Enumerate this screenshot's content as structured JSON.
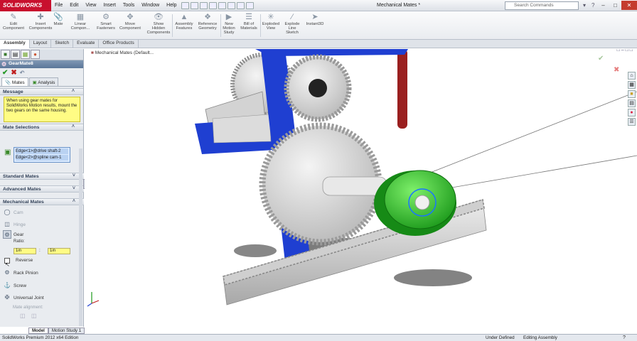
{
  "app": {
    "logo_text": "SOLIDWORKS",
    "document_title": "Mechanical Mates *"
  },
  "menu": [
    "File",
    "Edit",
    "View",
    "Insert",
    "Tools",
    "Window",
    "Help"
  ],
  "search": {
    "placeholder": "Search Commands"
  },
  "command_buttons": [
    {
      "label": "Edit\nComponent",
      "icon": "edit-icon"
    },
    {
      "label": "Insert\nComponents",
      "icon": "insert-icon"
    },
    {
      "label": "Mate",
      "icon": "mate-icon"
    },
    {
      "label": "Linear\nCompon...",
      "icon": "linear-icon"
    },
    {
      "label": "Smart\nFasteners",
      "icon": "fastener-icon"
    },
    {
      "label": "Move\nComponent",
      "icon": "move-icon"
    },
    {
      "label": "Show\nHidden\nComponents",
      "icon": "show-icon"
    },
    {
      "label": "Assembly\nFeatures",
      "icon": "features-icon"
    },
    {
      "label": "Reference\nGeometry",
      "icon": "geometry-icon"
    },
    {
      "label": "New\nMotion\nStudy",
      "icon": "motion-icon"
    },
    {
      "label": "Bill of\nMaterials",
      "icon": "bom-icon"
    },
    {
      "label": "Exploded\nView",
      "icon": "explode-icon"
    },
    {
      "label": "Explode\nLine\nSketch",
      "icon": "line-icon"
    },
    {
      "label": "Instant3D",
      "icon": "instant3d-icon"
    }
  ],
  "tabs": [
    "Assembly",
    "Layout",
    "Sketch",
    "Evaluate",
    "Office Products"
  ],
  "panel": {
    "title": "GearMate8",
    "mates_tab": "Mates",
    "analysis_tab": "Analysis",
    "message_header": "Message",
    "message_text": "When using gear mates for SolidWorks Motion results, mount the two gears on the same housing.",
    "selections_header": "Mate Selections",
    "selections": [
      "Edge<1>@drive shaft-2",
      "Edge<2>@spline cam-1"
    ],
    "standard_header": "Standard Mates",
    "advanced_header": "Advanced Mates",
    "mechanical_header": "Mechanical Mates",
    "cam": "Cam",
    "hinge": "Hinge",
    "gear": "Gear",
    "ratio_label": "Ratio:",
    "ratio_a": "1in",
    "ratio_colon": ":",
    "ratio_b": "1in",
    "reverse": "Reverse",
    "rack_pinion": "Rack Pinion",
    "screw": "Screw",
    "universal_joint": "Universal Joint",
    "mate_alignment": "Mate alignment:"
  },
  "viewport": {
    "tree_label": "Mechanical Mates  (Default..."
  },
  "bottom_tabs": [
    "Model",
    "Motion Study 1"
  ],
  "status": {
    "edition": "SolidWorks Premium 2012 x64 Edition",
    "state": "Under Defined",
    "mode": "Editing Assembly"
  },
  "colors": {
    "accent_red": "#c8102e",
    "cam_green": "#2fbf2a",
    "frame_blue": "#1f3fd1",
    "message_yellow": "#fffc84"
  }
}
